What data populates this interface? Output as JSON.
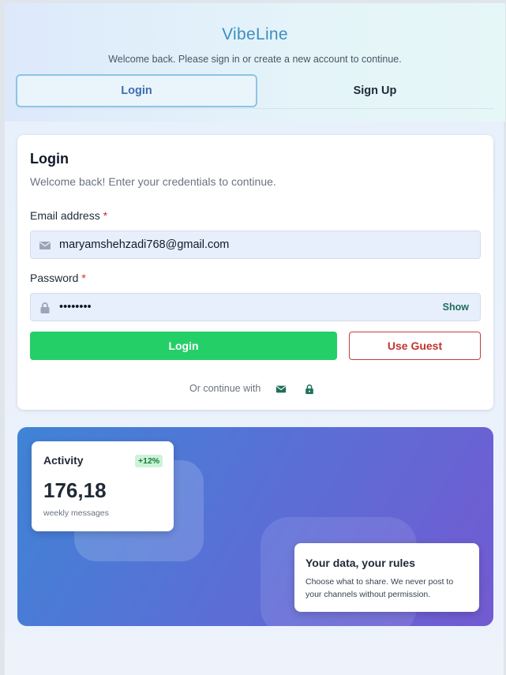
{
  "header": {
    "brand": "VibeLine",
    "subtitle": "Welcome back. Please sign in or create a new account to continue."
  },
  "tabs": [
    {
      "label": "Login",
      "active": true
    },
    {
      "label": "Sign Up",
      "active": false
    }
  ],
  "login_card": {
    "title": "Login",
    "subtitle": "Welcome back! Enter your credentials to continue.",
    "email": {
      "label": "Email address",
      "required_mark": "*",
      "value": "maryamshehzadi768@gmail.com",
      "icon": "mail-icon"
    },
    "password": {
      "label": "Password",
      "required_mark": "*",
      "value": "••••••••",
      "icon": "lock-icon",
      "toggle_label": "Show"
    },
    "login_button": "Login",
    "guest_button": "Use Guest",
    "continue_text": "Or continue with",
    "continue_icons": [
      "mail-icon",
      "lock-icon"
    ]
  },
  "hero": {
    "activity": {
      "title": "Activity",
      "badge": "+12%",
      "value": "176,18",
      "caption": "weekly messages"
    },
    "rules": {
      "title": "Your data, your rules",
      "text": "Choose what to share. We never post to your channels without permission."
    }
  },
  "colors": {
    "brand": "#3d8fc0",
    "primary_button": "#24cf67",
    "guest_border": "#c43c3c",
    "accent_text": "#1f6f5a"
  }
}
